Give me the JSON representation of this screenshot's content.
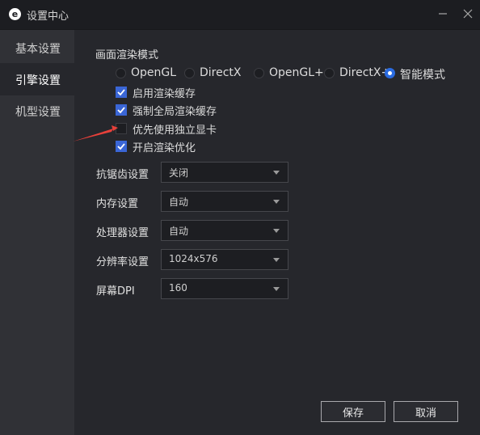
{
  "window": {
    "title": "设置中心",
    "logo_letter": "e"
  },
  "sidebar": {
    "items": [
      {
        "label": "基本设置",
        "active": false
      },
      {
        "label": "引擎设置",
        "active": true
      },
      {
        "label": "机型设置",
        "active": false
      }
    ]
  },
  "render_mode": {
    "title": "画面渲染模式",
    "options": [
      {
        "label": "OpenGL",
        "selected": false
      },
      {
        "label": "DirectX",
        "selected": false
      },
      {
        "label": "OpenGL+",
        "selected": false
      },
      {
        "label": "DirectX+",
        "selected": false
      },
      {
        "label": "智能模式",
        "selected": true
      }
    ]
  },
  "checkboxes": [
    {
      "label": "启用渲染缓存",
      "checked": true
    },
    {
      "label": "强制全局渲染缓存",
      "checked": true
    },
    {
      "label": "优先使用独立显卡",
      "checked": false
    },
    {
      "label": "开启渲染优化",
      "checked": true
    }
  ],
  "settings": [
    {
      "label": "抗锯齿设置",
      "value": "关闭"
    },
    {
      "label": "内存设置",
      "value": "自动"
    },
    {
      "label": "处理器设置",
      "value": "自动"
    },
    {
      "label": "分辨率设置",
      "value": "1024x576"
    },
    {
      "label": "屏幕DPI",
      "value": "160"
    }
  ],
  "buttons": {
    "save": "保存",
    "cancel": "取消"
  },
  "colors": {
    "accent": "#2a6be0",
    "checkbox": "#3a66d6",
    "annotation_arrow": "#e8403a"
  }
}
